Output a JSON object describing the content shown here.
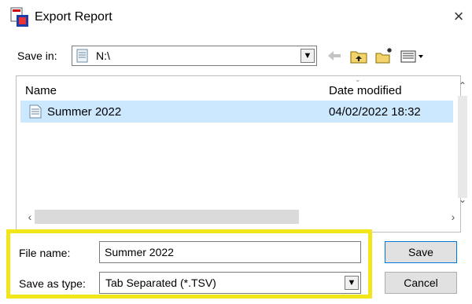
{
  "window": {
    "title": "Export Report",
    "app_icon": "export-report-app-icon",
    "close_glyph": "×"
  },
  "save_in": {
    "label": "Save in:",
    "value": "N:\\",
    "icon": "network-drive-icon"
  },
  "toolbar": {
    "icons": [
      "back-icon",
      "up-folder-icon",
      "new-folder-icon",
      "view-menu-icon"
    ]
  },
  "file_list": {
    "columns": [
      "Name",
      "Date modified"
    ],
    "rows": [
      {
        "name": "Summer 2022",
        "date": "04/02/2022 18:32",
        "icon": "document-icon",
        "selected": true
      }
    ]
  },
  "file_name": {
    "label": "File name:",
    "value": "Summer 2022"
  },
  "save_as_type": {
    "label": "Save as type:",
    "value": "Tab Separated (*.TSV)"
  },
  "buttons": {
    "save": "Save",
    "cancel": "Cancel"
  },
  "colors": {
    "selection": "#cce8ff",
    "highlight_frame": "#f2e61a",
    "default_button_border": "#0078d7"
  }
}
